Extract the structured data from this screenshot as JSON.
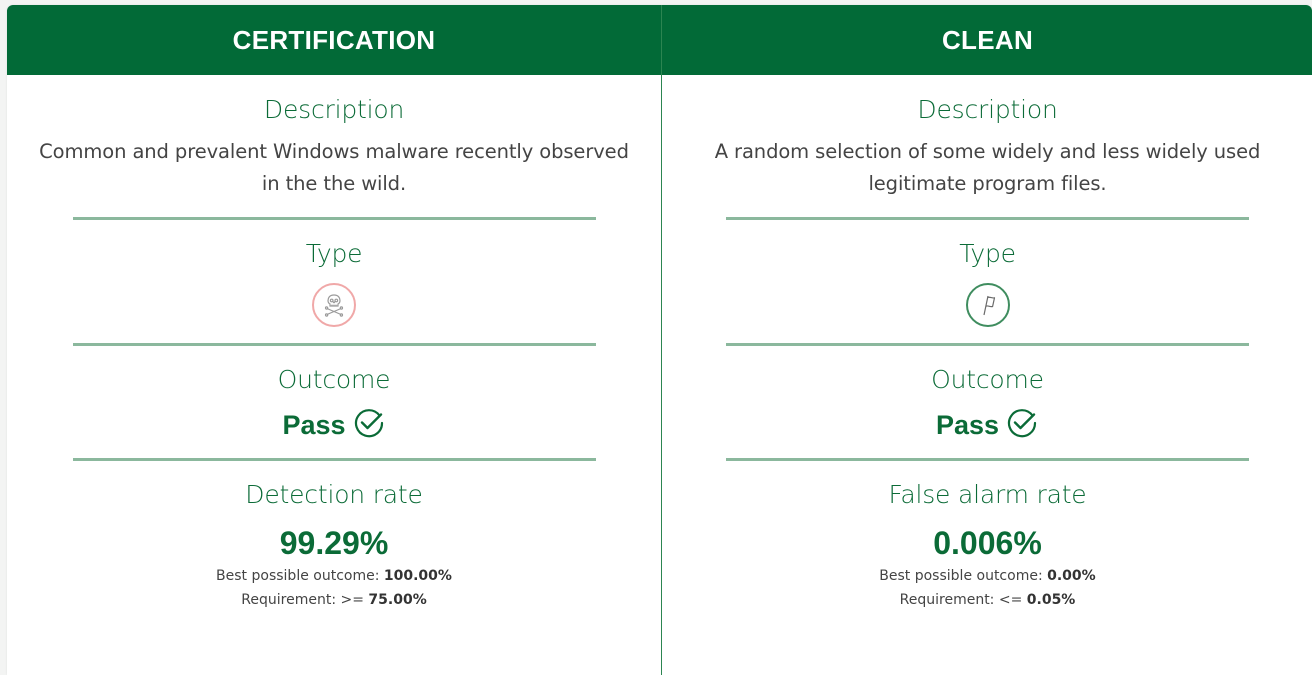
{
  "columns": [
    {
      "header": "CERTIFICATION",
      "description_title": "Description",
      "description_text": "Common and prevalent Windows malware recently observed in the the wild.",
      "type_title": "Type",
      "type_icon": "skull-crossbones-icon",
      "type_icon_color": "#f0a8a8",
      "outcome_title": "Outcome",
      "outcome_value": "Pass",
      "rate_title": "Detection rate",
      "rate_value": "99.29%",
      "best_label": "Best possible outcome: ",
      "best_value": "100.00%",
      "requirement_label": "Requirement: >= ",
      "requirement_value": "75.00%"
    },
    {
      "header": "CLEAN",
      "description_title": "Description",
      "description_text": "A random selection of some widely and less widely used legitimate program files.",
      "type_title": "Type",
      "type_icon": "flag-icon",
      "type_icon_color": "#3f8d5f",
      "outcome_title": "Outcome",
      "outcome_value": "Pass",
      "rate_title": "False alarm rate",
      "rate_value": "0.006%",
      "best_label": "Best possible outcome: ",
      "best_value": "0.00%",
      "requirement_label": "Requirement: <= ",
      "requirement_value": "0.05%"
    }
  ],
  "colors": {
    "header_bg": "#026a37",
    "accent_text": "#0b6b37",
    "divider": "#8bb89d"
  }
}
